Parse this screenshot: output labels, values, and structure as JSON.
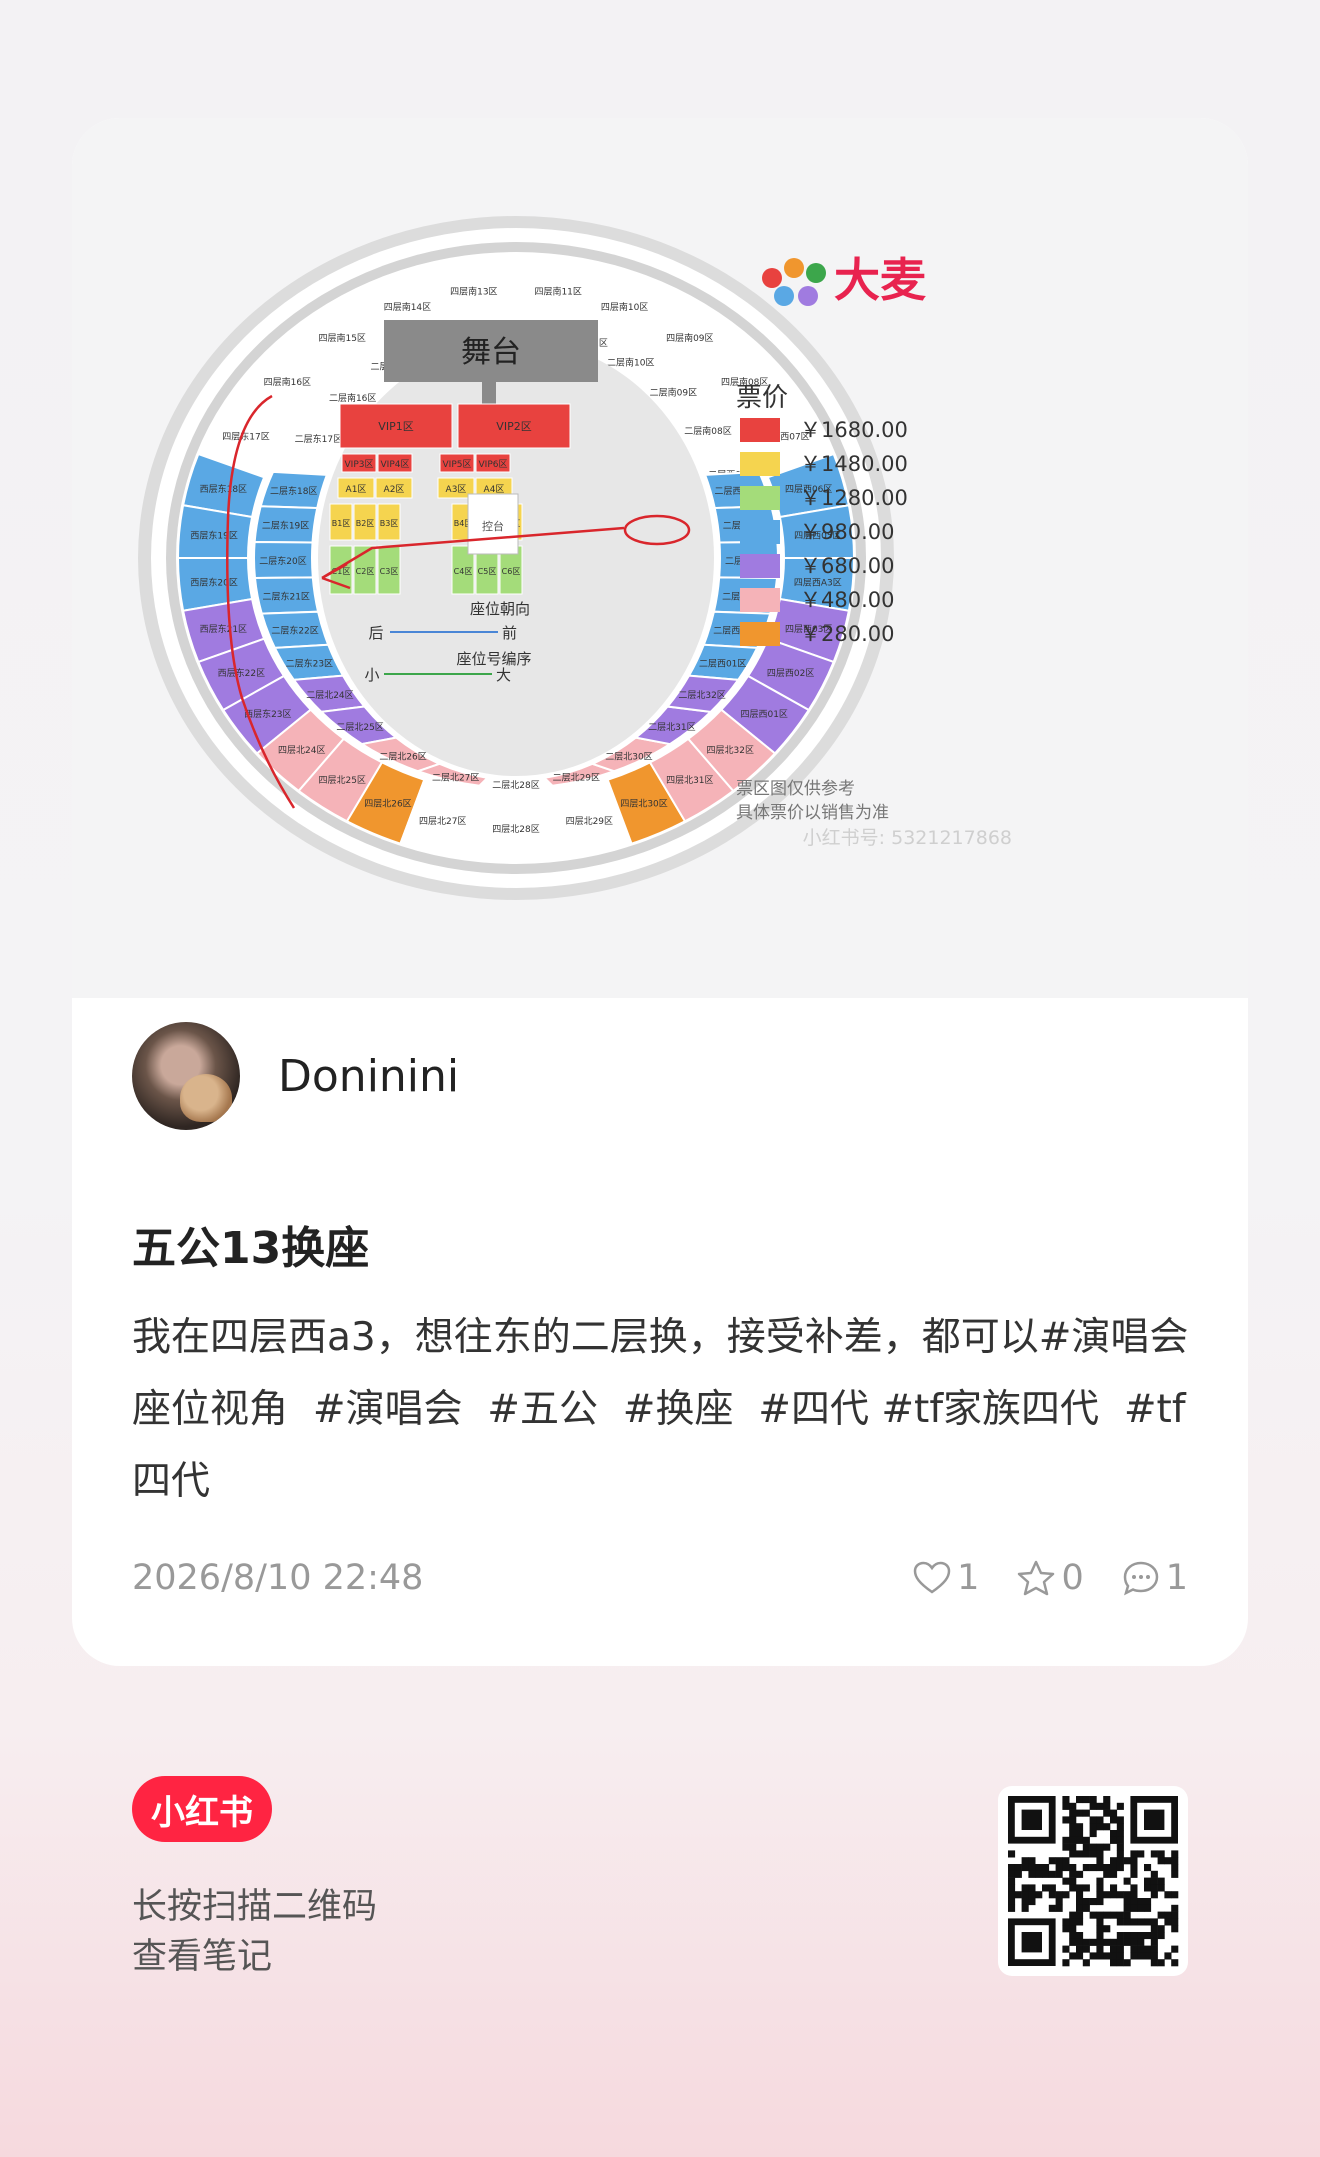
{
  "map": {
    "brand": "大麦",
    "stage": "舞台",
    "console": "控台",
    "legend_title": "票价",
    "legend": [
      {
        "price": "￥1680.00",
        "color": "#e8423f"
      },
      {
        "price": "￥1480.00",
        "color": "#f5d44f"
      },
      {
        "price": "￥1280.00",
        "color": "#a4dc7a"
      },
      {
        "price": "￥980.00",
        "color": "#5aa8e4"
      },
      {
        "price": "￥680.00",
        "color": "#a07be0"
      },
      {
        "price": "￥480.00",
        "color": "#f5b3b8"
      },
      {
        "price": "￥280.00",
        "color": "#f0962e"
      }
    ],
    "seat_direction_label": "座位朝向",
    "seat_direction_back": "后",
    "seat_direction_front": "前",
    "seat_number_label": "座位号编序",
    "seat_number_small": "小",
    "seat_number_big": "大",
    "disclaimer_line1": "票区图仅供参考",
    "disclaimer_line2": "具体票价以销售为准",
    "watermark": "小红书号: 5321217868",
    "vip_zones": [
      "VIP1区",
      "VIP2区",
      "VIP3区",
      "VIP4区",
      "VIP5区",
      "VIP6区"
    ],
    "a_zones": [
      "A1区",
      "A2区",
      "A3区",
      "A4区"
    ],
    "b_zones": [
      "B1区",
      "B2区",
      "B3区",
      "B4区",
      "B5区",
      "B6区"
    ],
    "c_zones": [
      "C1区",
      "C2区",
      "C3区",
      "C4区",
      "C5区",
      "C6区"
    ],
    "east_outer": [
      "西层东18区",
      "西层东19区",
      "西层东20区",
      "西层东21区",
      "西层东22区",
      "西层东23区"
    ],
    "east_inner": [
      "二层东18区",
      "二层东19区",
      "二层东20区",
      "二层东21区",
      "二层东22区",
      "二层东23区"
    ],
    "west_outer": [
      "四层西06区",
      "四层西05区",
      "四层西A3区",
      "四层西03区",
      "四层西02区",
      "四层西01区"
    ],
    "west_inner": [
      "二层西06区",
      "二层西05区",
      "二层西A3区",
      "二层西03区",
      "二层西02区",
      "二层西01区"
    ],
    "south_outer": [
      "四层南13区",
      "四层南14区",
      "四层南15区",
      "四层南16区",
      "四层东17区",
      "四层南11区",
      "四层南10区",
      "四层南09区",
      "四层南08区",
      "四层西07区"
    ],
    "south_inner": [
      "二层南13区",
      "二层南14区",
      "二层南15区",
      "二层南16区",
      "二层东17区",
      "二层南12区",
      "二层南11区",
      "二层南10区",
      "二层南09区",
      "二层南08区",
      "二层西07区"
    ],
    "north_outer": [
      "四层北24区",
      "四层北25区",
      "四层北26区",
      "四层北27区",
      "四层北28区",
      "四层北29区",
      "四层北30区",
      "四层北31区",
      "四层北32区"
    ],
    "north_inner": [
      "二层北24区",
      "二层北25区",
      "二层北26区",
      "二层北27区",
      "二层北28区",
      "二层北29区",
      "二层北30区",
      "二层北31区",
      "二层北32区"
    ]
  },
  "author": {
    "name": "Doninini"
  },
  "post": {
    "title": "五公13换座",
    "body_text": "我在四层西a3，想往东的二层换，接受补差，都可以",
    "tags": [
      "#演唱会座位视角",
      "#演唱会",
      "#五公",
      "#换座",
      "#四代",
      "#tf家族四代",
      "#tf四代"
    ],
    "date": "2026/8/10 22:48",
    "likes": "1",
    "favorites": "0",
    "comments": "1"
  },
  "footer": {
    "logo": "小红书",
    "line1": "长按扫描二维码",
    "line2": "查看笔记"
  }
}
